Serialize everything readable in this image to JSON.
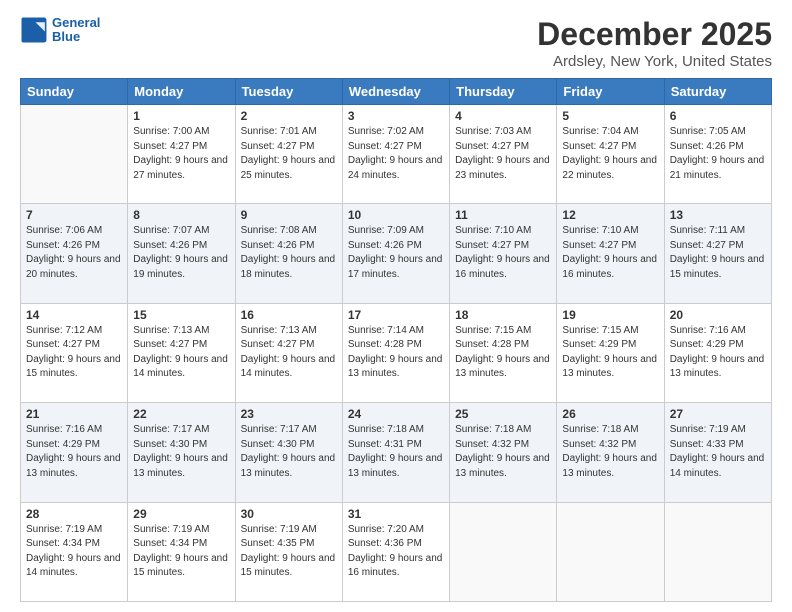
{
  "logo": {
    "line1": "General",
    "line2": "Blue"
  },
  "title": "December 2025",
  "subtitle": "Ardsley, New York, United States",
  "days_of_week": [
    "Sunday",
    "Monday",
    "Tuesday",
    "Wednesday",
    "Thursday",
    "Friday",
    "Saturday"
  ],
  "weeks": [
    [
      {
        "day": "",
        "sunrise": "",
        "sunset": "",
        "daylight": ""
      },
      {
        "day": "1",
        "sunrise": "Sunrise: 7:00 AM",
        "sunset": "Sunset: 4:27 PM",
        "daylight": "Daylight: 9 hours and 27 minutes."
      },
      {
        "day": "2",
        "sunrise": "Sunrise: 7:01 AM",
        "sunset": "Sunset: 4:27 PM",
        "daylight": "Daylight: 9 hours and 25 minutes."
      },
      {
        "day": "3",
        "sunrise": "Sunrise: 7:02 AM",
        "sunset": "Sunset: 4:27 PM",
        "daylight": "Daylight: 9 hours and 24 minutes."
      },
      {
        "day": "4",
        "sunrise": "Sunrise: 7:03 AM",
        "sunset": "Sunset: 4:27 PM",
        "daylight": "Daylight: 9 hours and 23 minutes."
      },
      {
        "day": "5",
        "sunrise": "Sunrise: 7:04 AM",
        "sunset": "Sunset: 4:27 PM",
        "daylight": "Daylight: 9 hours and 22 minutes."
      },
      {
        "day": "6",
        "sunrise": "Sunrise: 7:05 AM",
        "sunset": "Sunset: 4:26 PM",
        "daylight": "Daylight: 9 hours and 21 minutes."
      }
    ],
    [
      {
        "day": "7",
        "sunrise": "Sunrise: 7:06 AM",
        "sunset": "Sunset: 4:26 PM",
        "daylight": "Daylight: 9 hours and 20 minutes."
      },
      {
        "day": "8",
        "sunrise": "Sunrise: 7:07 AM",
        "sunset": "Sunset: 4:26 PM",
        "daylight": "Daylight: 9 hours and 19 minutes."
      },
      {
        "day": "9",
        "sunrise": "Sunrise: 7:08 AM",
        "sunset": "Sunset: 4:26 PM",
        "daylight": "Daylight: 9 hours and 18 minutes."
      },
      {
        "day": "10",
        "sunrise": "Sunrise: 7:09 AM",
        "sunset": "Sunset: 4:26 PM",
        "daylight": "Daylight: 9 hours and 17 minutes."
      },
      {
        "day": "11",
        "sunrise": "Sunrise: 7:10 AM",
        "sunset": "Sunset: 4:27 PM",
        "daylight": "Daylight: 9 hours and 16 minutes."
      },
      {
        "day": "12",
        "sunrise": "Sunrise: 7:10 AM",
        "sunset": "Sunset: 4:27 PM",
        "daylight": "Daylight: 9 hours and 16 minutes."
      },
      {
        "day": "13",
        "sunrise": "Sunrise: 7:11 AM",
        "sunset": "Sunset: 4:27 PM",
        "daylight": "Daylight: 9 hours and 15 minutes."
      }
    ],
    [
      {
        "day": "14",
        "sunrise": "Sunrise: 7:12 AM",
        "sunset": "Sunset: 4:27 PM",
        "daylight": "Daylight: 9 hours and 15 minutes."
      },
      {
        "day": "15",
        "sunrise": "Sunrise: 7:13 AM",
        "sunset": "Sunset: 4:27 PM",
        "daylight": "Daylight: 9 hours and 14 minutes."
      },
      {
        "day": "16",
        "sunrise": "Sunrise: 7:13 AM",
        "sunset": "Sunset: 4:27 PM",
        "daylight": "Daylight: 9 hours and 14 minutes."
      },
      {
        "day": "17",
        "sunrise": "Sunrise: 7:14 AM",
        "sunset": "Sunset: 4:28 PM",
        "daylight": "Daylight: 9 hours and 13 minutes."
      },
      {
        "day": "18",
        "sunrise": "Sunrise: 7:15 AM",
        "sunset": "Sunset: 4:28 PM",
        "daylight": "Daylight: 9 hours and 13 minutes."
      },
      {
        "day": "19",
        "sunrise": "Sunrise: 7:15 AM",
        "sunset": "Sunset: 4:29 PM",
        "daylight": "Daylight: 9 hours and 13 minutes."
      },
      {
        "day": "20",
        "sunrise": "Sunrise: 7:16 AM",
        "sunset": "Sunset: 4:29 PM",
        "daylight": "Daylight: 9 hours and 13 minutes."
      }
    ],
    [
      {
        "day": "21",
        "sunrise": "Sunrise: 7:16 AM",
        "sunset": "Sunset: 4:29 PM",
        "daylight": "Daylight: 9 hours and 13 minutes."
      },
      {
        "day": "22",
        "sunrise": "Sunrise: 7:17 AM",
        "sunset": "Sunset: 4:30 PM",
        "daylight": "Daylight: 9 hours and 13 minutes."
      },
      {
        "day": "23",
        "sunrise": "Sunrise: 7:17 AM",
        "sunset": "Sunset: 4:30 PM",
        "daylight": "Daylight: 9 hours and 13 minutes."
      },
      {
        "day": "24",
        "sunrise": "Sunrise: 7:18 AM",
        "sunset": "Sunset: 4:31 PM",
        "daylight": "Daylight: 9 hours and 13 minutes."
      },
      {
        "day": "25",
        "sunrise": "Sunrise: 7:18 AM",
        "sunset": "Sunset: 4:32 PM",
        "daylight": "Daylight: 9 hours and 13 minutes."
      },
      {
        "day": "26",
        "sunrise": "Sunrise: 7:18 AM",
        "sunset": "Sunset: 4:32 PM",
        "daylight": "Daylight: 9 hours and 13 minutes."
      },
      {
        "day": "27",
        "sunrise": "Sunrise: 7:19 AM",
        "sunset": "Sunset: 4:33 PM",
        "daylight": "Daylight: 9 hours and 14 minutes."
      }
    ],
    [
      {
        "day": "28",
        "sunrise": "Sunrise: 7:19 AM",
        "sunset": "Sunset: 4:34 PM",
        "daylight": "Daylight: 9 hours and 14 minutes."
      },
      {
        "day": "29",
        "sunrise": "Sunrise: 7:19 AM",
        "sunset": "Sunset: 4:34 PM",
        "daylight": "Daylight: 9 hours and 15 minutes."
      },
      {
        "day": "30",
        "sunrise": "Sunrise: 7:19 AM",
        "sunset": "Sunset: 4:35 PM",
        "daylight": "Daylight: 9 hours and 15 minutes."
      },
      {
        "day": "31",
        "sunrise": "Sunrise: 7:20 AM",
        "sunset": "Sunset: 4:36 PM",
        "daylight": "Daylight: 9 hours and 16 minutes."
      },
      {
        "day": "",
        "sunrise": "",
        "sunset": "",
        "daylight": ""
      },
      {
        "day": "",
        "sunrise": "",
        "sunset": "",
        "daylight": ""
      },
      {
        "day": "",
        "sunrise": "",
        "sunset": "",
        "daylight": ""
      }
    ]
  ]
}
